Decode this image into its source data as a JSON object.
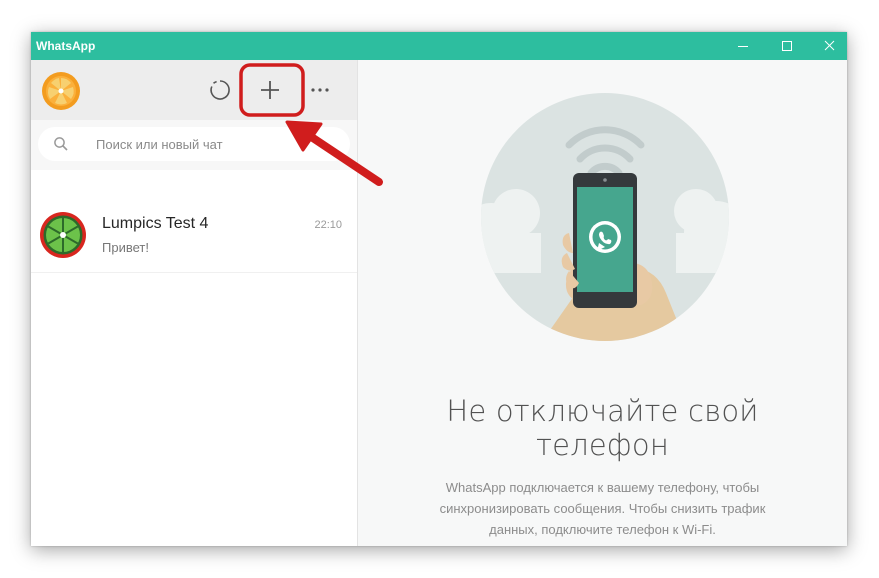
{
  "window": {
    "title": "WhatsApp",
    "accent_color": "#2dbe9f",
    "controls": [
      "minimize-icon",
      "maximize-icon",
      "close-icon"
    ]
  },
  "sidebar": {
    "header": {
      "status_icon": "status-icon",
      "new_chat_icon": "plus-icon",
      "menu_icon": "more-icon"
    },
    "search": {
      "placeholder": "Поиск или новый чат",
      "value": "",
      "icon": "search-icon"
    },
    "chats": [
      {
        "name": "Lumpics Test 4",
        "time": "22:10",
        "preview": "Привет!"
      }
    ]
  },
  "main": {
    "title": "Не отключайте свой телефон",
    "description": "WhatsApp подключается к вашему телефону, чтобы синхронизировать сообщения. Чтобы снизить трафик данных, подключите телефон к Wi-Fi."
  },
  "annotation": {
    "highlight_color": "#d01d1d"
  }
}
